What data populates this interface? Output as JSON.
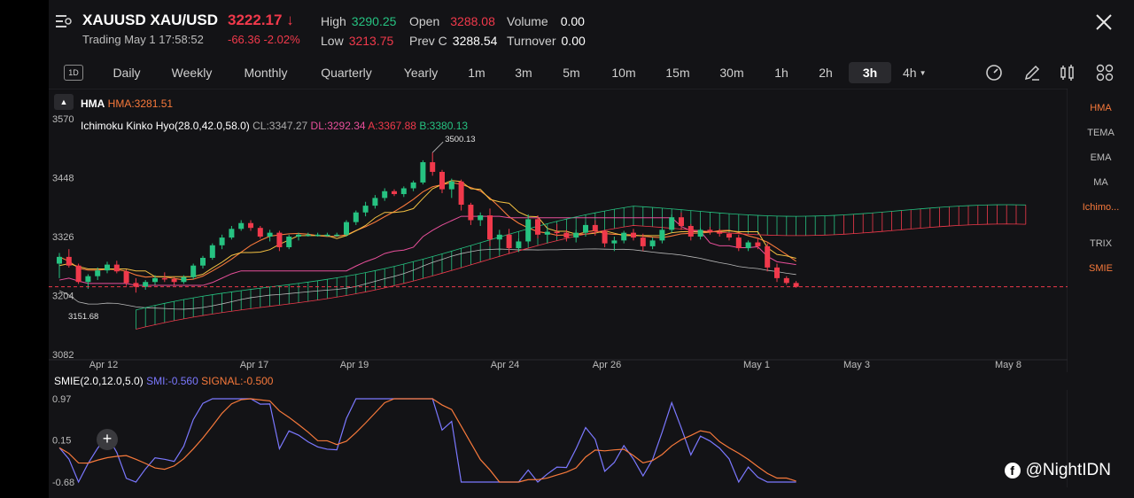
{
  "header": {
    "symbol": "XAUUSD XAU/USD",
    "price": "3222.17",
    "trading": "Trading  May 1 17:58:52",
    "change": "-66.36  -2.02%",
    "high_label": "High",
    "high": "3290.25",
    "low_label": "Low",
    "low": "3213.75",
    "open_label": "Open",
    "open": "3288.08",
    "prevc_label": "Prev C",
    "prevc": "3288.54",
    "volume_label": "Volume",
    "volume": "0.00",
    "turnover_label": "Turnover",
    "turnover": "0.00"
  },
  "timeframes": [
    "1D",
    "Daily",
    "Weekly",
    "Monthly",
    "Quarterly",
    "Yearly",
    "1m",
    "3m",
    "5m",
    "10m",
    "15m",
    "30m",
    "1h",
    "2h",
    "3h",
    "4h"
  ],
  "selected_timeframe": "3h",
  "indicators": {
    "hma_name": "HMA",
    "hma_value": "HMA:3281.51",
    "ichimoku_name": "Ichimoku Kinko Hyo(28.0,42.0,58.0)",
    "cl": "CL:3347.27",
    "dl": "DL:3292.34",
    "a": "A:3367.88",
    "b": "B:3380.13",
    "smie_name": "SMIE(2.0,12.0,5.0)",
    "smi": "SMI:-0.560",
    "signal": "SIGNAL:-0.500"
  },
  "side_menu": [
    "HMA",
    "TEMA",
    "EMA",
    "MA",
    "Ichimo...",
    "TRIX",
    "SMIE"
  ],
  "side_menu_active": [
    "HMA",
    "Ichimo...",
    "SMIE"
  ],
  "price_axis": [
    "3570",
    "3448",
    "3326",
    "3204",
    "3082"
  ],
  "price_markers": {
    "high": "3500.13",
    "low": "3151.68"
  },
  "date_axis": [
    "Apr 12",
    "Apr 17",
    "Apr 19",
    "Apr 24",
    "Apr 26",
    "May 1",
    "May 3",
    "May 8"
  ],
  "smie_axis": [
    "0.97",
    "0.15",
    "-0.68"
  ],
  "watermark": "@NightIDN",
  "colors": {
    "up": "#26c281",
    "down": "#f0394b",
    "hma": "#f7793b",
    "conv": "#f5c242",
    "base": "#e84f9a",
    "lag": "#b9b9b9",
    "smi": "#7b78ff",
    "signal": "#f7793b"
  },
  "chart_data": {
    "type": "candlestick",
    "ylim": [
      3082,
      3570
    ],
    "candles": [
      [
        3270,
        3292,
        3240,
        3284
      ],
      [
        3284,
        3300,
        3262,
        3266
      ],
      [
        3266,
        3270,
        3228,
        3232
      ],
      [
        3232,
        3248,
        3218,
        3244
      ],
      [
        3244,
        3262,
        3236,
        3256
      ],
      [
        3256,
        3274,
        3250,
        3268
      ],
      [
        3268,
        3276,
        3250,
        3254
      ],
      [
        3254,
        3258,
        3224,
        3230
      ],
      [
        3230,
        3240,
        3210,
        3222
      ],
      [
        3222,
        3236,
        3216,
        3232
      ],
      [
        3232,
        3246,
        3226,
        3240
      ],
      [
        3240,
        3252,
        3232,
        3238
      ],
      [
        3238,
        3242,
        3226,
        3232
      ],
      [
        3232,
        3246,
        3228,
        3242
      ],
      [
        3242,
        3270,
        3238,
        3266
      ],
      [
        3266,
        3286,
        3260,
        3282
      ],
      [
        3282,
        3312,
        3278,
        3308
      ],
      [
        3308,
        3330,
        3300,
        3324
      ],
      [
        3324,
        3348,
        3320,
        3342
      ],
      [
        3342,
        3360,
        3338,
        3354
      ],
      [
        3354,
        3360,
        3338,
        3344
      ],
      [
        3344,
        3348,
        3322,
        3326
      ],
      [
        3326,
        3340,
        3316,
        3334
      ],
      [
        3334,
        3338,
        3296,
        3304
      ],
      [
        3304,
        3330,
        3300,
        3326
      ],
      [
        3326,
        3334,
        3318,
        3330
      ],
      [
        3330,
        3334,
        3326,
        3330
      ],
      [
        3330,
        3334,
        3326,
        3330
      ],
      [
        3330,
        3334,
        3326,
        3330
      ],
      [
        3330,
        3334,
        3326,
        3330
      ],
      [
        3330,
        3360,
        3326,
        3356
      ],
      [
        3356,
        3380,
        3350,
        3376
      ],
      [
        3376,
        3398,
        3368,
        3390
      ],
      [
        3390,
        3412,
        3384,
        3406
      ],
      [
        3406,
        3426,
        3400,
        3420
      ],
      [
        3420,
        3424,
        3410,
        3414
      ],
      [
        3414,
        3430,
        3408,
        3426
      ],
      [
        3426,
        3442,
        3420,
        3438
      ],
      [
        3438,
        3484,
        3434,
        3480
      ],
      [
        3480,
        3500,
        3452,
        3460
      ],
      [
        3460,
        3464,
        3416,
        3424
      ],
      [
        3424,
        3446,
        3406,
        3440
      ],
      [
        3440,
        3444,
        3380,
        3392
      ],
      [
        3392,
        3396,
        3350,
        3360
      ],
      [
        3360,
        3376,
        3348,
        3370
      ],
      [
        3370,
        3384,
        3306,
        3320
      ],
      [
        3320,
        3340,
        3296,
        3330
      ],
      [
        3330,
        3342,
        3290,
        3302
      ],
      [
        3302,
        3322,
        3294,
        3316
      ],
      [
        3316,
        3372,
        3312,
        3362
      ],
      [
        3362,
        3370,
        3322,
        3330
      ],
      [
        3330,
        3344,
        3312,
        3336
      ],
      [
        3336,
        3352,
        3326,
        3334
      ],
      [
        3334,
        3340,
        3316,
        3324
      ],
      [
        3324,
        3340,
        3314,
        3334
      ],
      [
        3334,
        3356,
        3326,
        3350
      ],
      [
        3350,
        3360,
        3328,
        3338
      ],
      [
        3338,
        3340,
        3304,
        3312
      ],
      [
        3312,
        3326,
        3296,
        3318
      ],
      [
        3318,
        3338,
        3312,
        3334
      ],
      [
        3334,
        3342,
        3318,
        3324
      ],
      [
        3324,
        3332,
        3296,
        3306
      ],
      [
        3306,
        3324,
        3300,
        3318
      ],
      [
        3318,
        3346,
        3312,
        3340
      ],
      [
        3340,
        3372,
        3334,
        3366
      ],
      [
        3366,
        3376,
        3340,
        3348
      ],
      [
        3348,
        3352,
        3318,
        3326
      ],
      [
        3326,
        3344,
        3320,
        3340
      ],
      [
        3340,
        3346,
        3330,
        3336
      ],
      [
        3336,
        3342,
        3326,
        3332
      ],
      [
        3332,
        3334,
        3318,
        3324
      ],
      [
        3324,
        3330,
        3296,
        3302
      ],
      [
        3302,
        3318,
        3296,
        3314
      ],
      [
        3314,
        3324,
        3300,
        3306
      ],
      [
        3306,
        3312,
        3254,
        3262
      ],
      [
        3262,
        3270,
        3232,
        3240
      ],
      [
        3240,
        3244,
        3226,
        3230
      ],
      [
        3230,
        3234,
        3220,
        3222
      ]
    ],
    "last_price": 3222.17,
    "smie": {
      "ylim": [
        -0.68,
        0.97
      ]
    }
  }
}
